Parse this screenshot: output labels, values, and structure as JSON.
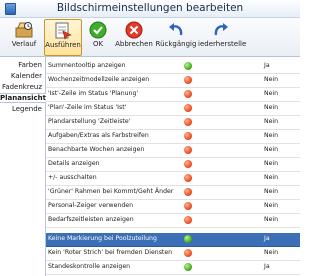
{
  "window": {
    "title": "Bildschirmeinstellungen bearbeiten"
  },
  "toolbar": {
    "buttons": [
      {
        "label": "Verlauf",
        "icon": "history-icon"
      },
      {
        "label": "Ausführen",
        "icon": "execute-icon",
        "active": true
      },
      {
        "label": "OK",
        "icon": "ok-check-icon"
      },
      {
        "label": "Abbrechen",
        "icon": "cancel-x-icon"
      },
      {
        "label": "Rückgängig",
        "icon": "undo-icon"
      },
      {
        "label": "iederherstelle",
        "icon": "redo-icon"
      }
    ]
  },
  "sidebar": {
    "items": [
      {
        "label": "Farben"
      },
      {
        "label": "Kalender"
      },
      {
        "label": "Fadenkreuz"
      },
      {
        "label": "Planansicht",
        "selected": true
      },
      {
        "label": "Legende"
      }
    ]
  },
  "settings": {
    "rows": [
      {
        "label": "Summentooltip anzeigen",
        "status": "green",
        "value": "Ja"
      },
      {
        "label": "Wochenzeitmodellzeile anzeigen",
        "status": "red",
        "value": "Nein"
      },
      {
        "label": "'Ist'-Zeile im Status 'Planung'",
        "status": "red",
        "value": "Nein"
      },
      {
        "label": "'Plan'-Zeile im Status 'Ist'",
        "status": "red",
        "value": "Nein"
      },
      {
        "label": "Plandarstellung 'Zeitleiste'",
        "status": "red",
        "value": "Nein"
      },
      {
        "label": "Aufgaben/Extras als Farbstreifen",
        "status": "red",
        "value": "Nein"
      },
      {
        "label": "Benachbarte Wochen anzeigen",
        "status": "red",
        "value": "Nein"
      },
      {
        "label": "Details anzeigen",
        "status": "red",
        "value": "Nein"
      },
      {
        "label": "+/- ausschalten",
        "status": "red",
        "value": "Nein"
      },
      {
        "label": "'Grüner' Rahmen bei Kommt/Geht Änder",
        "status": "red",
        "value": "Nein"
      },
      {
        "label": "Personal-Zeiger verwenden",
        "status": "red",
        "value": "Nein"
      },
      {
        "label": "Bedarfszeitleisten anzeigen",
        "status": "red",
        "value": "Nein"
      },
      {
        "label": "Keine Markierung bei Poolzuteilung",
        "status": "green",
        "value": "Ja",
        "selected": true
      },
      {
        "label": "Kein 'Roter Strich' bei fremden Diensten",
        "status": "red",
        "value": "Nein"
      },
      {
        "label": "Standeskontrolle anzeigen",
        "status": "green",
        "value": "Ja"
      }
    ]
  },
  "colors": {
    "accent": "#3d6fb6",
    "status_green": "#3aa416",
    "status_red": "#e8441b"
  }
}
